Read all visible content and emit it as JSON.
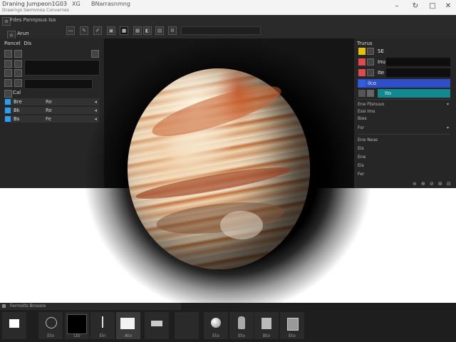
{
  "titlebar": {
    "title": "Draning Jumpeon1G03",
    "subtitle": "Drawings Swrmmoa Convernes",
    "menu_a": "XG",
    "menu_b": "BNarrasnmng",
    "minimize": "–",
    "restore": "↻",
    "maximize": "□",
    "close": "✕"
  },
  "toolbar": {
    "label": "Fdes Pannpsus Isa",
    "sub_label": "Arun"
  },
  "left_panel": {
    "title": "Pancel",
    "title_suffix": "Dis",
    "section_label": "Cal",
    "rows": [
      {
        "label": "Bre",
        "value": "Re"
      },
      {
        "label": "Bk",
        "value": "Re"
      },
      {
        "label": "Bs",
        "value": "Fe"
      }
    ]
  },
  "right_panel": {
    "title": "Trurus",
    "layers": [
      {
        "name": "SE",
        "thumb_color": "#e6c200",
        "fill_color": "#1a1a1a"
      },
      {
        "name": "Inu",
        "thumb_color": "#e04a4a",
        "fill_color": "#0e0e0e"
      },
      {
        "name": "Ite",
        "thumb_color": "#e04a4a",
        "fill_color": "#0e0e0e"
      },
      {
        "name": "ilco",
        "thumb_color": "#2f5fe0",
        "fill_color": "#2f4fc9"
      },
      {
        "name": "Ito",
        "thumb_color": "#2aa7a7",
        "fill_color": "#11898f"
      }
    ],
    "props_a": [
      "Ene Ftsnuuo",
      "Essi Ims",
      "Bies",
      "Fsr"
    ],
    "props_b": [
      "Ene Neas",
      "Eis",
      "Ene",
      "Eis",
      "Fer"
    ],
    "footer": [
      "≡",
      "⊕",
      "⊘",
      "⊞",
      "⊟"
    ]
  },
  "bottom": {
    "tab_label": "Fermolts Brossre",
    "tools": [
      {
        "label": "",
        "icon": "brush-icon"
      },
      {
        "label": "Eto",
        "icon": "clock-icon"
      },
      {
        "label": "Lto",
        "icon": "black-square-icon"
      },
      {
        "label": "Eln",
        "icon": "pen-icon"
      },
      {
        "label": "Ato",
        "icon": "folder-icon"
      },
      {
        "label": "",
        "icon": "rect-icon"
      },
      {
        "label": "",
        "icon": "empty-icon"
      },
      {
        "label": "Eto",
        "icon": "sphere-icon"
      },
      {
        "label": "Eto",
        "icon": "figure-icon"
      },
      {
        "label": "Bto",
        "icon": "book-icon"
      },
      {
        "label": "Eto",
        "icon": "page-icon"
      }
    ]
  },
  "colors": {
    "accent_blue": "#2a9df4",
    "teal": "#11898f",
    "yellow": "#e6c200"
  }
}
